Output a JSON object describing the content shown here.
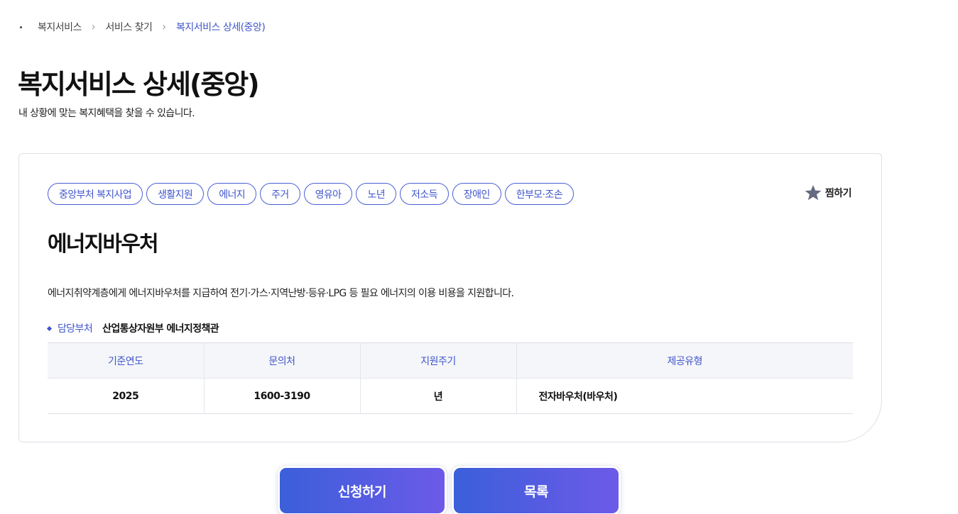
{
  "breadcrumb": {
    "items": [
      "복지서비스",
      "서비스 찾기"
    ],
    "current": "복지서비스 상세(중앙)"
  },
  "page": {
    "title": "복지서비스 상세(중앙)",
    "description": "내 상황에 맞는 복지혜택을 찾을 수 있습니다."
  },
  "card": {
    "tags": [
      "중앙부처 복지사업",
      "생활지원",
      "에너지",
      "주거",
      "영유아",
      "노년",
      "저소득",
      "장애인",
      "한부모·조손"
    ],
    "favorite_label": "찜하기",
    "favorite_icon": "star-icon",
    "service_title": "에너지바우처",
    "service_description": "에너지취약계층에게 에너지바우처를 지급하여 전기·가스·지역난방·등유·LPG 등 필요 에너지의 이용 비용을 지원합니다.",
    "department": {
      "label": "담당부처",
      "value": "산업통상자원부 에너지정책관"
    },
    "table": {
      "headers": [
        "기준연도",
        "문의처",
        "지원주기",
        "제공유형"
      ],
      "row": [
        "2025",
        "1600-3190",
        "년",
        "전자바우처(바우처)"
      ]
    }
  },
  "buttons": {
    "apply": "신청하기",
    "list": "목록"
  },
  "colors": {
    "accent": "#3f55cc",
    "button_gradient_start": "#3b5fda",
    "button_gradient_end": "#6c5ae8"
  }
}
